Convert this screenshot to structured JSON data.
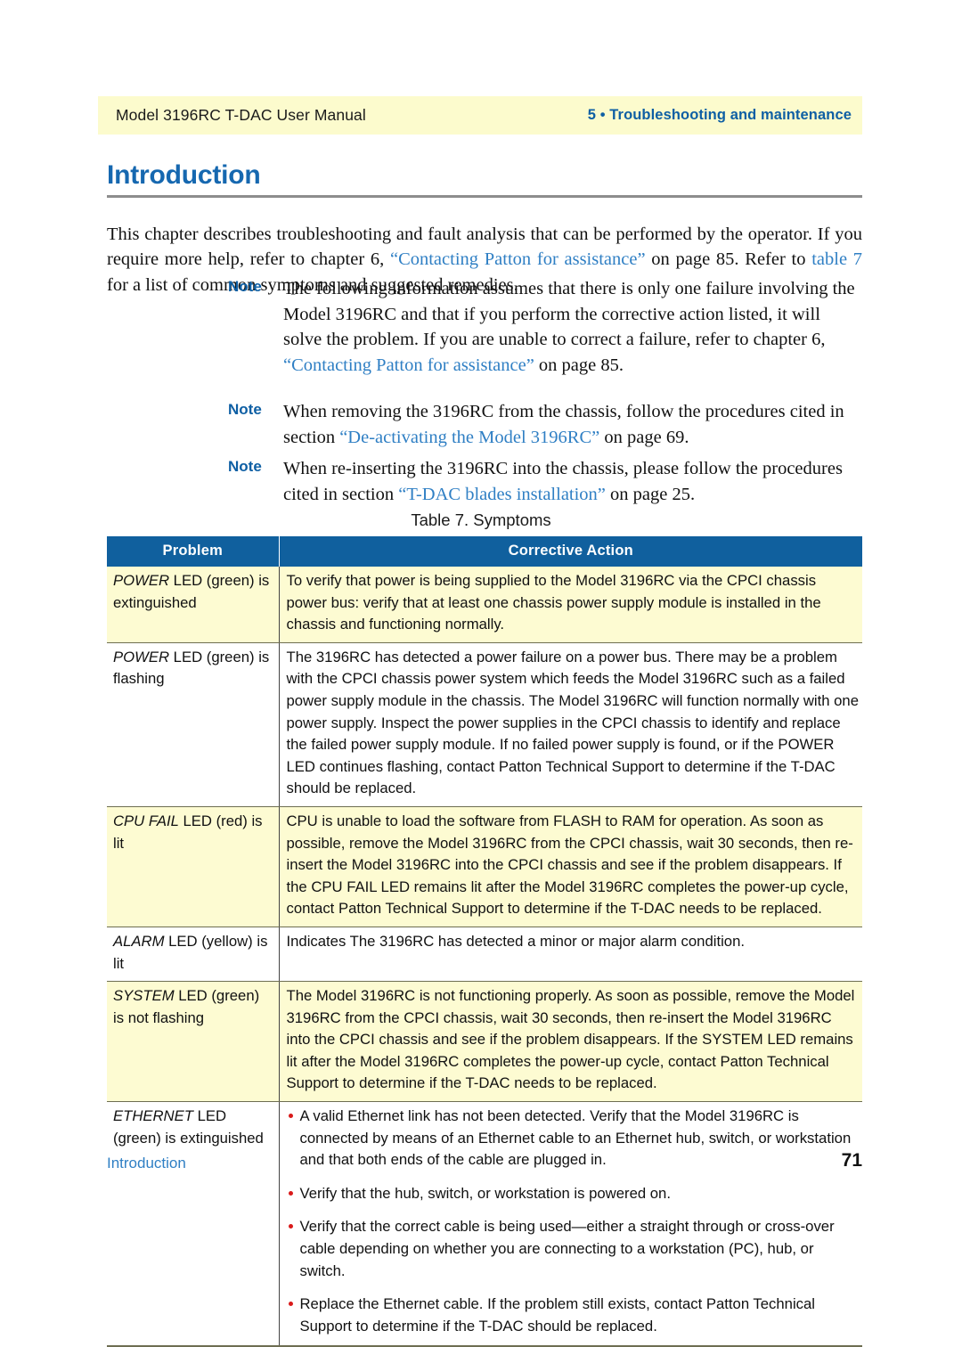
{
  "header": {
    "left": "Model 3196RC T-DAC User Manual",
    "right": "5 • Troubleshooting and maintenance"
  },
  "section": {
    "title": "Introduction",
    "intro_part1": "This chapter describes troubleshooting and fault analysis that can be performed by the operator. If you require more help, refer to chapter 6, ",
    "intro_link1": "“Contacting Patton for assistance”",
    "intro_part2": " on page 85. Refer to ",
    "intro_link2": "table 7",
    "intro_part3": " for a list of common symptoms and suggested remedies."
  },
  "notes": [
    {
      "label": "Note",
      "text_part1": "The following information assumes that there is only one failure involving the Model 3196RC and that if you perform the corrective action listed, it will solve the problem. If you are unable to correct a failure, refer to chapter 6, ",
      "link": "“Contacting Patton for assistance”",
      "text_part2": " on page 85."
    },
    {
      "label": "Note",
      "text_part1": "When removing the 3196RC from the chassis, follow the procedures cited in section ",
      "link": "“De-activating the Model 3196RC”",
      "text_part2": " on page 69."
    },
    {
      "label": "Note",
      "text_part1": "When re-inserting the 3196RC into the chassis, please follow the procedures cited in section ",
      "link": "“T-DAC blades installation”",
      "text_part2": " on page 25."
    }
  ],
  "table": {
    "caption": "Table 7. Symptoms",
    "columns": [
      "Problem",
      "Corrective Action"
    ],
    "rows": [
      {
        "problem_em": "POWER",
        "problem_rest": " LED (green) is extinguished",
        "action": "To verify that power is being supplied to the Model 3196RC via the CPCI chassis power bus: verify that at least one chassis power supply module is installed in the chassis and functioning normally."
      },
      {
        "problem_em": "POWER",
        "problem_rest": " LED (green) is flashing",
        "action": "The 3196RC has detected a power failure on a power bus. There may be a problem with the CPCI chassis power system which feeds the Model 3196RC such as a failed power supply module in the chassis. The Model 3196RC will function normally with one power supply. Inspect the power supplies in the CPCI chassis to identify and replace the failed power supply module. If no failed power supply is found, or if the POWER LED continues flashing, contact Patton Technical Support to determine if the T-DAC should be replaced."
      },
      {
        "problem_em": "CPU FAIL",
        "problem_rest": " LED (red) is lit",
        "action": "CPU is unable to load the software from FLASH to RAM for operation. As soon as possible, remove the Model 3196RC from the CPCI chassis, wait 30 seconds, then re-insert the Model 3196RC into the CPCI chassis and see if the problem disappears. If the CPU FAIL LED remains lit after the Model 3196RC completes the power-up cycle, contact Patton Technical Support to determine if the T-DAC needs to be replaced."
      },
      {
        "problem_em": "ALARM",
        "problem_rest": " LED (yellow) is lit",
        "action": "Indicates The 3196RC has detected a minor or major alarm condition."
      },
      {
        "problem_em": "SYSTEM",
        "problem_rest": " LED (green) is not flashing",
        "action": "The Model 3196RC is not functioning properly. As soon as possible, remove the Model 3196RC from the CPCI chassis, wait 30 seconds, then re-insert the Model 3196RC into the CPCI chassis and see if the problem disappears. If the SYSTEM LED remains lit after the Model 3196RC completes the power-up cycle, contact Patton Technical Support to determine if the T-DAC needs to be replaced."
      },
      {
        "problem_em": "ETHERNET",
        "problem_rest": " LED (green) is extinguished",
        "action_bullets": [
          "A valid Ethernet link has not been detected. Verify that the Model 3196RC is connected by means of an Ethernet cable to an Ethernet hub, switch, or workstation and that both ends of the cable are plugged in.",
          "Verify that the hub, switch, or workstation is powered on.",
          "Verify that the correct cable is being used—either a straight through or cross-over cable depending on whether you are connecting to a workstation (PC), hub, or switch.",
          "Replace the Ethernet cable. If the problem still exists, contact Patton Technical Support to determine if the T-DAC should be replaced."
        ]
      }
    ]
  },
  "footer": {
    "left": "Introduction",
    "page_number": "71"
  },
  "colors": {
    "header_band": "#fcfbcd",
    "accent_blue": "#0e5fa4",
    "link_blue": "#2f7fc4",
    "table_header_blue": "#10609e",
    "row_shade": "#fdfbd2",
    "bullet_red": "#d91a1a"
  }
}
